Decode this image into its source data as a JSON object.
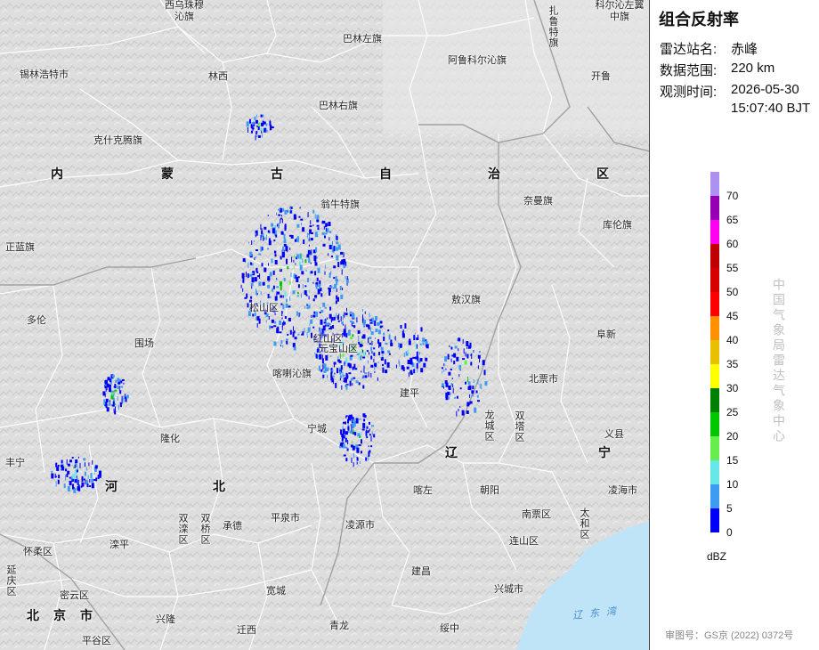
{
  "map": {
    "places": [
      {
        "name": "西乌珠穆沁旗",
        "kind": "wrap2"
      },
      {
        "name": "扎鲁特旗",
        "kind": "vertical"
      },
      {
        "name": "科尔沁左翼中旗",
        "kind": "wrap-right"
      },
      {
        "name": "锡林浩特市"
      },
      {
        "name": "巴林左旗"
      },
      {
        "name": "阿鲁科尔沁旗"
      },
      {
        "name": "林西"
      },
      {
        "name": "开鲁"
      },
      {
        "name": "巴林右旗"
      },
      {
        "name": "克什克腾旗"
      },
      {
        "name": "翁牛特旗"
      },
      {
        "name": "奈曼旗"
      },
      {
        "name": "库伦旗"
      },
      {
        "name": "正蓝旗"
      },
      {
        "name": "敖汉旗"
      },
      {
        "name": "多伦"
      },
      {
        "name": "松山区"
      },
      {
        "name": "红山区"
      },
      {
        "name": "元宝山区"
      },
      {
        "name": "阜新"
      },
      {
        "name": "围场"
      },
      {
        "name": "喀喇沁旗"
      },
      {
        "name": "北票市"
      },
      {
        "name": "建平"
      },
      {
        "name": "龙城区",
        "kind": "vertical"
      },
      {
        "name": "双塔区",
        "kind": "vertical"
      },
      {
        "name": "宁城"
      },
      {
        "name": "隆化"
      },
      {
        "name": "义县",
        "kind": "wrap2"
      },
      {
        "name": "丰宁"
      },
      {
        "name": "喀左"
      },
      {
        "name": "朝阳"
      },
      {
        "name": "凌海市"
      },
      {
        "name": "双滦区",
        "kind": "vertical"
      },
      {
        "name": "双桥区",
        "kind": "vertical"
      },
      {
        "name": "承德"
      },
      {
        "name": "平泉市"
      },
      {
        "name": "南票区"
      },
      {
        "name": "太和区",
        "kind": "vertical"
      },
      {
        "name": "怀柔区"
      },
      {
        "name": "滦平"
      },
      {
        "name": "凌源市"
      },
      {
        "name": "连山区"
      },
      {
        "name": "延庆区",
        "kind": "vertical"
      },
      {
        "name": "建昌"
      },
      {
        "name": "密云区"
      },
      {
        "name": "宽城"
      },
      {
        "name": "兴城市"
      },
      {
        "name": "兴隆"
      },
      {
        "name": "迁西"
      },
      {
        "name": "青龙"
      },
      {
        "name": "绥中"
      },
      {
        "name": "平谷区"
      }
    ],
    "province_chars": [
      "内",
      "蒙",
      "古",
      "自",
      "治",
      "区",
      "辽",
      "宁",
      "河",
      "北",
      "北",
      "京",
      "市"
    ],
    "sea_label": "辽东湾",
    "colors": {
      "land": "#dcdcdc",
      "water": "#bfe4f7",
      "border": "#ffffff",
      "province_border": "#9a9a9a"
    }
  },
  "info": {
    "title": "组合反射率",
    "station_label": "雷达站名:",
    "station_value": "赤峰",
    "range_label": "数据范围:",
    "range_value": "220 km",
    "time_label": "观测时间:",
    "time_value_date": "2026-05-30",
    "time_value_time": "15:07:40 BJT"
  },
  "legend": {
    "unit": "dBZ",
    "levels": [
      {
        "label": "70",
        "color": "#ad90f0"
      },
      {
        "label": "65",
        "color": "#9600b4"
      },
      {
        "label": "60",
        "color": "#ff00f0"
      },
      {
        "label": "55",
        "color": "#c00000"
      },
      {
        "label": "50",
        "color": "#d60000"
      },
      {
        "label": "45",
        "color": "#ff0000"
      },
      {
        "label": "40",
        "color": "#ff9000"
      },
      {
        "label": "35",
        "color": "#e7c000"
      },
      {
        "label": "30",
        "color": "#ffff00"
      },
      {
        "label": "25",
        "color": "#008000"
      },
      {
        "label": "20",
        "color": "#00c800"
      },
      {
        "label": "15",
        "color": "#66ee4d"
      },
      {
        "label": "10",
        "color": "#67e8e8"
      },
      {
        "label": "5",
        "color": "#3e9bf2"
      },
      {
        "label": "0",
        "color": "#0000f6"
      }
    ]
  },
  "agency": "中国气象局雷达气象中心",
  "approval": "审图号：GS京 (2022) 0372号"
}
